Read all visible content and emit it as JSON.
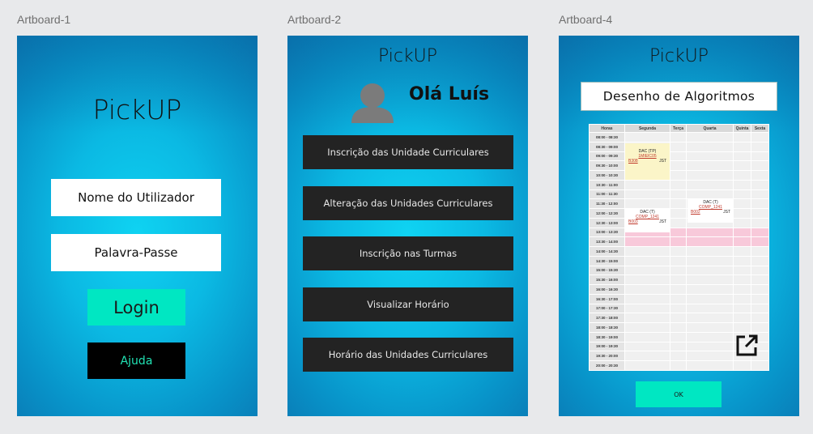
{
  "labels": [
    "Artboard-1",
    "Artboard-2",
    "Artboard-4"
  ],
  "artboard1": {
    "logo": "PickUP",
    "username_placeholder": "Nome do Utilizador",
    "password_placeholder": "Palavra-Passe",
    "login_label": "Login",
    "help_label": "Ajuda"
  },
  "artboard2": {
    "logo": "PickUP",
    "greeting": "Olá Luís",
    "menu": [
      "Inscrição das Unidade Curriculares",
      "Alteração das Unidades Curriculares",
      "Inscrição nas Turmas",
      "Visualizar Horário",
      "Horário das Unidades Curriculares"
    ]
  },
  "artboard4": {
    "logo": "PickUP",
    "course_title": "Desenho de Algoritmos",
    "schedule": {
      "headers": [
        "Horas",
        "Segunda",
        "Terça",
        "Quarta",
        "Quinta",
        "Sexta"
      ],
      "times": [
        "08:00 - 08:30",
        "08:30 - 09:00",
        "09:00 - 09:30",
        "09:30 - 10:00",
        "10:00 - 10:30",
        "10:30 - 11:00",
        "11:00 - 11:30",
        "11:30 - 12:00",
        "12:00 - 12:30",
        "12:30 - 13:00",
        "13:00 - 13:30",
        "13:30 - 14:00",
        "14:00 - 14:30",
        "14:30 - 15:00",
        "15:00 - 15:30",
        "15:30 - 16:00",
        "16:00 - 16:30",
        "16:30 - 17:00",
        "17:00 - 17:30",
        "17:30 - 18:00",
        "18:00 - 18:30",
        "18:30 - 19:00",
        "19:00 - 19:30",
        "19:30 - 20:00",
        "20:00 - 20:30"
      ],
      "events": [
        {
          "name": "DAC (TP)",
          "code": "1MIEIC05",
          "room": "B308",
          "teacher": "JST",
          "day": "Segunda",
          "color": "#fbf5c8"
        },
        {
          "name": "DAC (T)",
          "code": "COMP_1241",
          "room": "B003",
          "teacher": "JST",
          "day": "Segunda",
          "color": "#ffffff"
        },
        {
          "name": "DAC (T)",
          "code": "COMP_1241",
          "room": "B002",
          "teacher": "JST",
          "day": "Quarta",
          "color": "#ffffff"
        }
      ]
    },
    "ok_label": "OK"
  }
}
